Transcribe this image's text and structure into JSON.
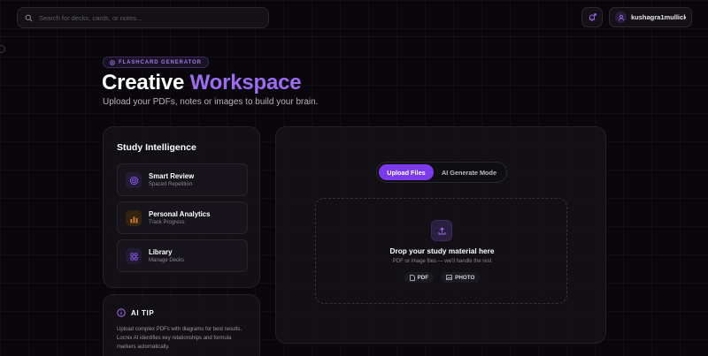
{
  "topbar": {
    "search_placeholder": "Search for decks, cards, or notes...",
    "username": "kushagra1mullick..."
  },
  "hero": {
    "badge": "FLASHCARD GENERATOR",
    "title_plain": "Creative ",
    "title_accent": "Workspace",
    "subtitle": "Upload your PDFs, notes or images to build your brain."
  },
  "intelligence": {
    "title": "Study Intelligence",
    "items": [
      {
        "icon": "target-icon",
        "title": "Smart Review",
        "subtitle": "Spaced Repetition",
        "color": "#8b5cf6"
      },
      {
        "icon": "bar-chart-icon",
        "title": "Personal Analytics",
        "subtitle": "Track Progress",
        "color": "#e8843a"
      },
      {
        "icon": "grid-icon",
        "title": "Library",
        "subtitle": "Manage Decks",
        "color": "#8b5cf6"
      }
    ]
  },
  "tip": {
    "title": "AI TIP",
    "body": "Upload complex PDFs with diagrams for best results. Locnix AI identifies key relationships and formula markers automatically."
  },
  "upload": {
    "tabs": [
      "Upload Files",
      "AI Generate Mode"
    ],
    "active_tab": "Upload Files",
    "drop_title": "Drop your study material here",
    "drop_subtitle": "PDF or image files — we'll handle the rest",
    "chips": [
      "PDF",
      "PHOTO"
    ]
  },
  "colors": {
    "accent": "#8b5cf6",
    "background": "#09070b",
    "panel": "#141218"
  }
}
